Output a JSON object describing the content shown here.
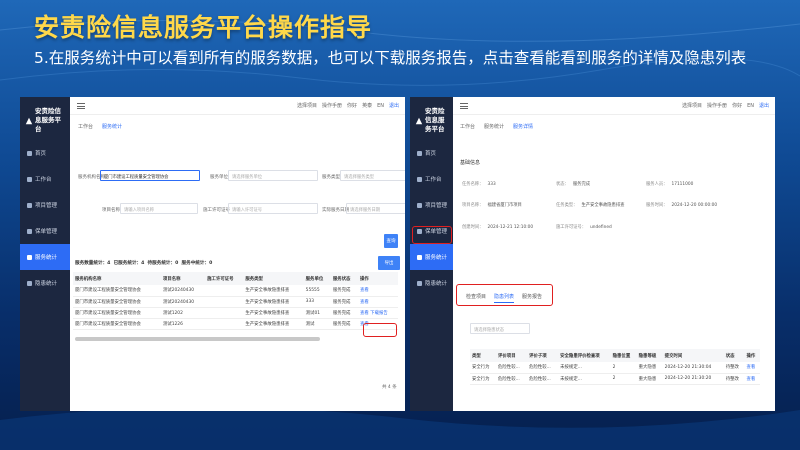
{
  "slide": {
    "title": "安责险信息服务平台操作指导",
    "desc": "5.在服务统计中可以看到所有的服务数据，也可以下载服务报告，点击查看能看到服务的详情及隐患列表"
  },
  "colors": {
    "sidebar": "#1c2740",
    "accent": "#2d6cf5",
    "highlight": "#e02020",
    "title": "#ffd84a"
  },
  "shot1": {
    "app_title": "安责险信息服务平台",
    "sidebar": [
      {
        "label": "首页",
        "icon": "home-icon"
      },
      {
        "label": "工作台",
        "icon": "workbench-icon"
      },
      {
        "label": "项目管理",
        "icon": "project-icon"
      },
      {
        "label": "保单管理",
        "icon": "policy-icon"
      },
      {
        "label": "服务统计",
        "icon": "stats-icon",
        "active": true
      },
      {
        "label": "隐患统计",
        "icon": "hazard-icon"
      }
    ],
    "topbar": {
      "menu_icon": "menu-icon",
      "l1": "选择项目",
      "l2": "操作手册",
      "user": "你好",
      "brand": "英泰",
      "lang": "EN",
      "logout": "退出"
    },
    "tabs": [
      "工作台",
      "服务统计"
    ],
    "filters": {
      "org_label": "服务机构名称",
      "org_value": "厦门市建设工程质量安全管理协会",
      "type_label": "服务单位",
      "type_placeholder": "请选择服务单位",
      "stype_label": "服务类型",
      "stype_placeholder": "请选择服务类型",
      "proj_label": "项目名称",
      "proj_placeholder": "请输入项目名称",
      "permit_label": "施工许可证号",
      "permit_placeholder": "请输入许可证号",
      "date_label": "实际服务日期",
      "date_placeholder": "请选择服务日期"
    },
    "search_button": "查询",
    "export_button": "导出",
    "stats": {
      "total": "服务数量统计：4",
      "done": "已服务统计：4",
      "pending": "待服务统计：0",
      "ongoing": "服务中统计：0"
    },
    "columns": [
      "服务机构名称",
      "项目名称",
      "施工许可证号",
      "服务类型",
      "服务单位",
      "服务状态",
      "操作"
    ],
    "rows": [
      [
        "厦门市建设工程质量安全管理协会",
        "测试20240430",
        "",
        "生产安全事故隐患排查",
        "55555",
        "服务完成",
        "查看",
        ""
      ],
      [
        "厦门市建设工程质量安全管理协会",
        "测试20240430",
        "",
        "生产安全事故隐患排查",
        "333",
        "服务完成",
        "查看",
        ""
      ],
      [
        "厦门市建设工程质量安全管理协会",
        "测试1202",
        "",
        "生产安全事故隐患排查",
        "测试01",
        "服务完成",
        "查看",
        "下载报告"
      ],
      [
        "厦门市建设工程质量安全管理协会",
        "测试1226",
        "",
        "生产安全事故隐患排查",
        "测试",
        "服务完成",
        "查看",
        ""
      ]
    ],
    "pager": "共 4 条"
  },
  "shot2": {
    "app_title": "安责险信息服务平台",
    "sidebar": [
      {
        "label": "首页",
        "icon": "home-icon"
      },
      {
        "label": "工作台",
        "icon": "workbench-icon"
      },
      {
        "label": "项目管理",
        "icon": "project-icon"
      },
      {
        "label": "保单管理",
        "icon": "policy-icon"
      },
      {
        "label": "服务统计",
        "icon": "stats-icon",
        "active": true
      },
      {
        "label": "隐患统计",
        "icon": "hazard-icon"
      }
    ],
    "topbar": {
      "l1": "选择项目",
      "l2": "操作手册",
      "user": "你好",
      "lang": "EN",
      "logout": "退出"
    },
    "tabs": [
      "工作台",
      "服务统计",
      "服务详情"
    ],
    "section": "基础信息",
    "info": [
      {
        "k": "任务名称：",
        "v": "333"
      },
      {
        "k": "状态：",
        "v": "服务完成"
      },
      {
        "k": "服务人员：",
        "v": "17111000"
      },
      {
        "k": "项目名称：",
        "v": "福建省厦门市项目"
      },
      {
        "k": "任务类型：",
        "v": "生产安全事故隐患排查"
      },
      {
        "k": "服务时间：",
        "v": "2024-12-20 00:00:00"
      },
      {
        "k": "创建时间：",
        "v": "2024-12-21 12:10:00"
      },
      {
        "k": "施工许可证号：",
        "v": "undefined"
      }
    ],
    "subtabs": [
      "检查项目",
      "隐患列表",
      "服务报告"
    ],
    "filter_placeholder": "请选择隐患状态",
    "columns": [
      "类型",
      "评价项目",
      "评价子项",
      "安全隐患评价检查项",
      "隐患位置",
      "隐患等级",
      "提交时间",
      "状态",
      "操作"
    ],
    "rows": [
      [
        "安全行为",
        "危险性较...",
        "危险性较...",
        "未按规定...",
        "2",
        "重大隐患",
        "2024-12-20 21:30:04",
        "待整改",
        "查看"
      ],
      [
        "安全行为",
        "危险性较...",
        "危险性较...",
        "未按规定...",
        "2",
        "重大隐患",
        "2024-12-20 21:30:20",
        "待整改",
        "查看"
      ]
    ]
  }
}
